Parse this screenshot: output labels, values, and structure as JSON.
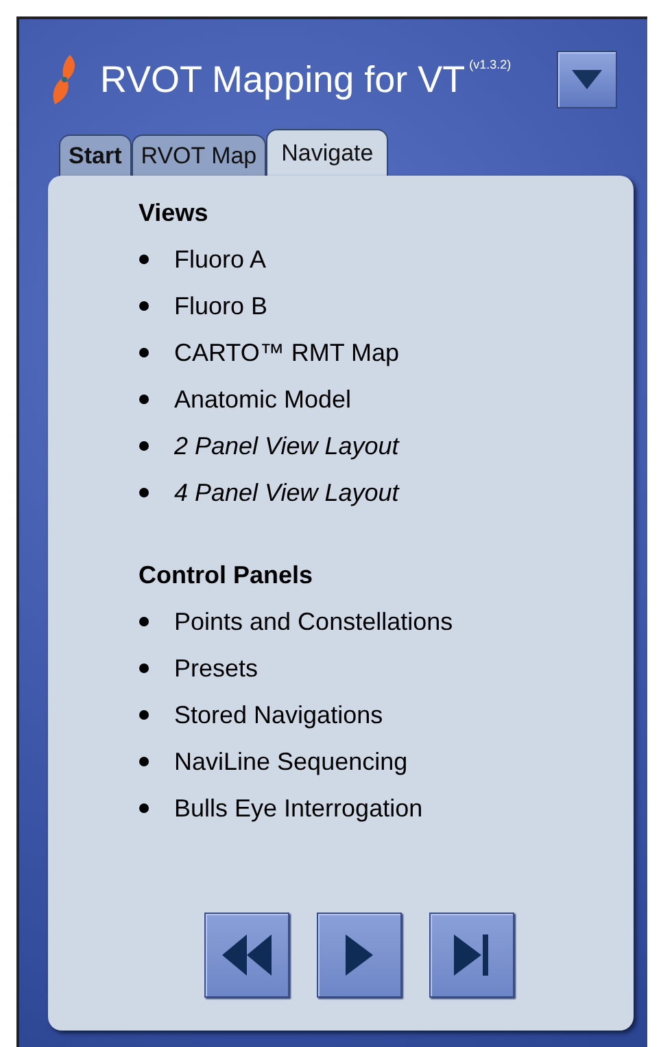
{
  "header": {
    "title": "RVOT Mapping for VT",
    "version": "(v1.3.2)"
  },
  "tabs": [
    {
      "label": "Start",
      "selected": false,
      "bold": true
    },
    {
      "label": "RVOT Map",
      "selected": false,
      "bold": false
    },
    {
      "label": "Navigate",
      "selected": true,
      "bold": false
    }
  ],
  "sections": [
    {
      "heading": "Views",
      "items": [
        {
          "label": "Fluoro A",
          "italic": false
        },
        {
          "label": "Fluoro B",
          "italic": false
        },
        {
          "label": "CARTO™ RMT Map",
          "italic": false
        },
        {
          "label": "Anatomic Model",
          "italic": false
        },
        {
          "label": "2 Panel View Layout",
          "italic": true
        },
        {
          "label": "4 Panel View Layout",
          "italic": true
        }
      ]
    },
    {
      "heading": "Control Panels",
      "items": [
        {
          "label": "Points and Constellations",
          "italic": false
        },
        {
          "label": "Presets",
          "italic": false
        },
        {
          "label": "Stored Navigations",
          "italic": false
        },
        {
          "label": "NaviLine Sequencing",
          "italic": false
        },
        {
          "label": "Bulls Eye Interrogation",
          "italic": false
        }
      ]
    }
  ],
  "nav_buttons": [
    {
      "kind": "rewind"
    },
    {
      "kind": "play"
    },
    {
      "kind": "skip-end"
    }
  ]
}
